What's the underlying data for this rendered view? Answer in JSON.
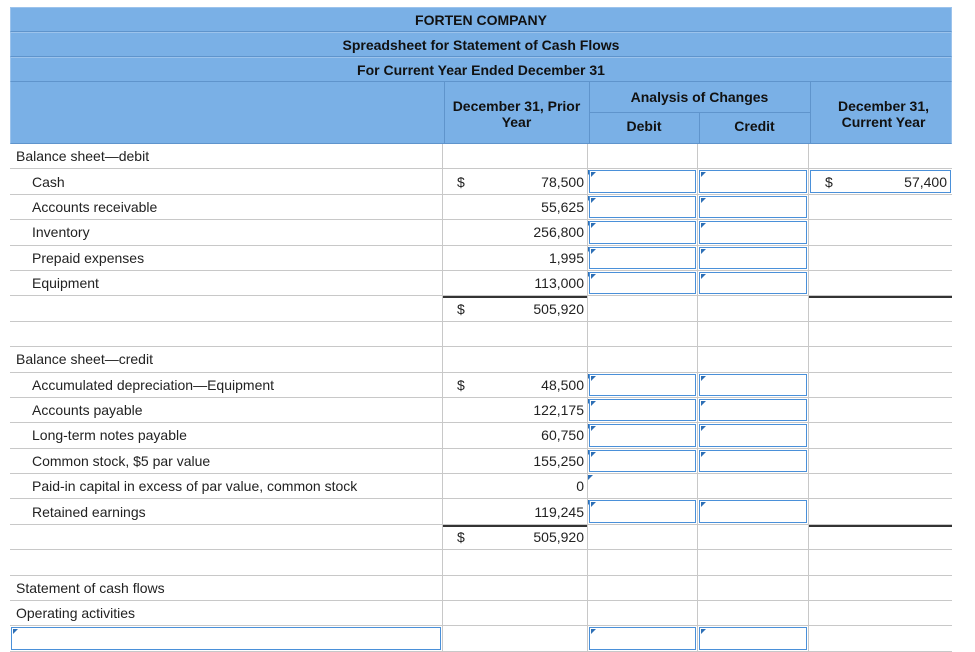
{
  "title": {
    "company": "FORTEN COMPANY",
    "statement": "Spreadsheet for Statement of Cash Flows",
    "period": "For Current Year Ended December 31"
  },
  "columns": {
    "prior": "December 31, Prior Year",
    "analysis": "Analysis of Changes",
    "debit": "Debit",
    "credit": "Credit",
    "current": "December 31, Current Year"
  },
  "sections": {
    "debit_header": "Balance sheet—debit",
    "credit_header": "Balance sheet—credit",
    "cash_flows": "Statement of cash flows",
    "operating": "Operating activities"
  },
  "debit_rows": [
    {
      "label": "Cash",
      "dollar": "$",
      "prior": "78,500",
      "current_dollar": "$",
      "current": "57,400"
    },
    {
      "label": "Accounts receivable",
      "prior": "55,625"
    },
    {
      "label": "Inventory",
      "prior": "256,800"
    },
    {
      "label": "Prepaid expenses",
      "prior": "1,995"
    },
    {
      "label": "Equipment",
      "prior": "113,000"
    }
  ],
  "debit_total": {
    "dollar": "$",
    "value": "505,920"
  },
  "credit_rows": [
    {
      "label": "Accumulated depreciation—Equipment",
      "dollar": "$",
      "prior": "48,500"
    },
    {
      "label": "Accounts payable",
      "prior": "122,175"
    },
    {
      "label": "Long-term notes payable",
      "prior": "60,750"
    },
    {
      "label": "Common stock, $5 par value",
      "prior": "155,250"
    },
    {
      "label": "Paid-in capital in excess of par value, common stock",
      "prior": "0"
    },
    {
      "label": "Retained earnings",
      "prior": "119,245"
    }
  ],
  "credit_total": {
    "dollar": "$",
    "value": "505,920"
  }
}
